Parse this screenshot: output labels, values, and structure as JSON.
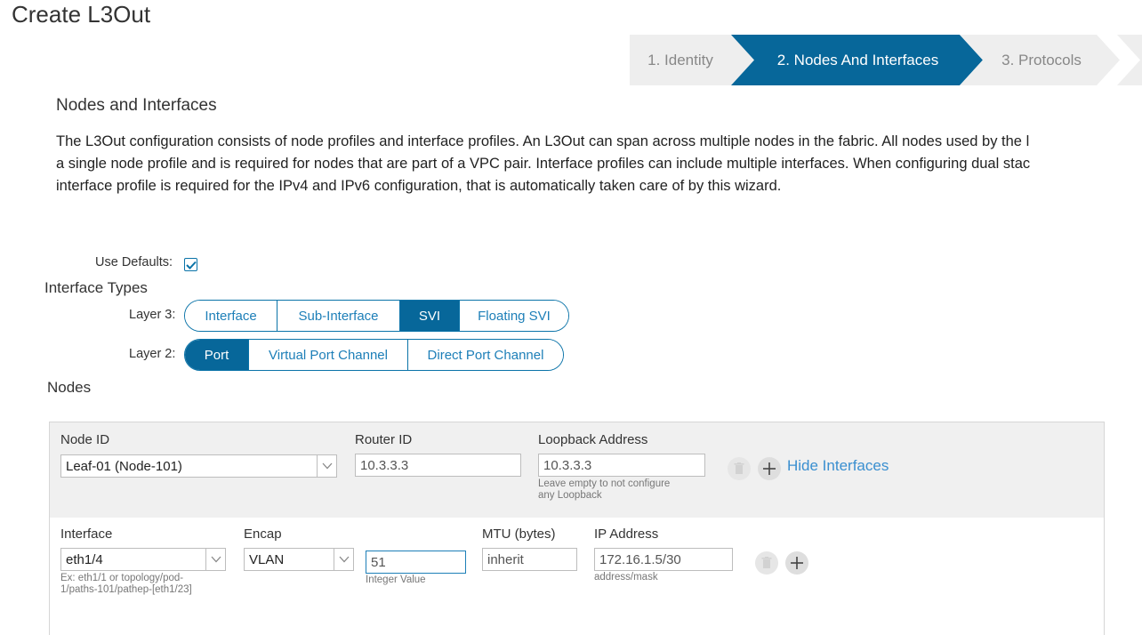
{
  "page": {
    "title": "Create L3Out"
  },
  "wizard": {
    "steps": [
      {
        "label": "1. Identity",
        "state": "inactive"
      },
      {
        "label": "2. Nodes And Interfaces",
        "state": "active"
      },
      {
        "label": "3. Protocols",
        "state": "inactive"
      }
    ]
  },
  "section": {
    "title": "Nodes and Interfaces",
    "description": [
      "The L3Out configuration consists of node profiles and interface profiles. An L3Out can span across multiple nodes in the fabric. All nodes used by the l",
      "a single node profile and is required for nodes that are part of a VPC pair. Interface profiles can include multiple interfaces. When configuring dual stac",
      "interface profile is required for the IPv4 and IPv6 configuration, that is automatically taken care of by this wizard."
    ]
  },
  "use_defaults": {
    "label": "Use Defaults:",
    "checked": true
  },
  "interface_types": {
    "title": "Interface Types",
    "layer3": {
      "label": "Layer 3:",
      "options": [
        "Interface",
        "Sub-Interface",
        "SVI",
        "Floating SVI"
      ],
      "selected": "SVI"
    },
    "layer2": {
      "label": "Layer 2:",
      "options": [
        "Port",
        "Virtual Port Channel",
        "Direct Port Channel"
      ],
      "selected": "Port"
    }
  },
  "nodes": {
    "title": "Nodes",
    "node_id": {
      "label": "Node ID",
      "value": "Leaf-01 (Node-101)"
    },
    "router_id": {
      "label": "Router ID",
      "value": "10.3.3.3"
    },
    "loopback": {
      "label": "Loopback Address",
      "value": "10.3.3.3",
      "hint_line1": "Leave empty to not configure",
      "hint_line2": "any Loopback"
    },
    "hide_interfaces_label": "Hide Interfaces"
  },
  "interface_row": {
    "interface": {
      "label": "Interface",
      "value": "eth1/4",
      "hint_line1": "Ex: eth1/1 or topology/pod-",
      "hint_line2": "1/paths-101/pathep-[eth1/23]"
    },
    "encap": {
      "label": "Encap",
      "value": "VLAN"
    },
    "vlan_value": {
      "value": "51",
      "hint": "Integer Value"
    },
    "mtu": {
      "label": "MTU (bytes)",
      "value": "inherit"
    },
    "ip_address": {
      "label": "IP Address",
      "value": "172.16.1.5/30",
      "hint": "address/mask"
    }
  },
  "colors": {
    "primary": "#07679a",
    "link": "#3a8fd0",
    "inactive_step": "#eeeeee"
  },
  "icons": [
    "check-icon",
    "chevron-down-icon",
    "trash-icon",
    "plus-icon"
  ]
}
